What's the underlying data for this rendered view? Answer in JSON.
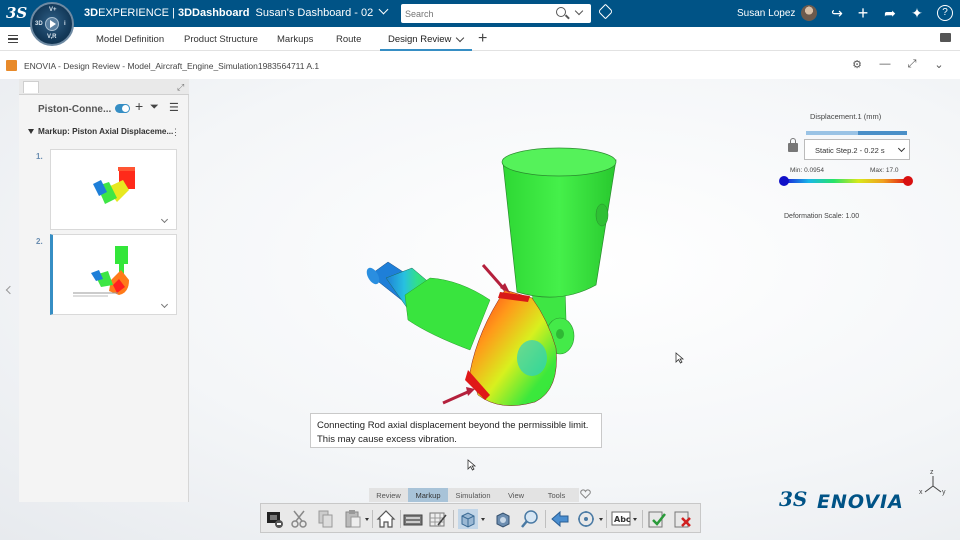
{
  "topbar": {
    "brand_bold": "3D",
    "brand_rest": "EXPERIENCE | ",
    "brand_app": "3DDashboard",
    "dashboard_name": "Susan's Dashboard - 02",
    "search_placeholder": "Search",
    "username": "Susan Lopez",
    "compass_quadrants": [
      "3D",
      "V,R",
      "i",
      "V+"
    ]
  },
  "tabs": [
    {
      "label": "Model Definition"
    },
    {
      "label": "Product Structure"
    },
    {
      "label": "Markups"
    },
    {
      "label": "Route"
    },
    {
      "label": "Design Review"
    }
  ],
  "app": {
    "title": "ENOVIA - Design Review - Model_Aircraft_Engine_Simulation1983564711 A.1"
  },
  "panel": {
    "title": "Piston-Conne...",
    "markup_label": "Markup: Piston Axial Displaceme...",
    "thumbnails": [
      {
        "num": "1."
      },
      {
        "num": "2."
      }
    ]
  },
  "legend": {
    "title": "Displacement.1 (mm)",
    "step": "Static Step.2 - 0.22 s",
    "min": "Min: 0.0954",
    "max": "Max: 17.0",
    "deformation": "Deformation Scale: 1.00"
  },
  "note": {
    "line1": "Connecting Rod axial displacement beyond the permissible limit.",
    "line2": "This may cause excess vibration."
  },
  "command_tabs": [
    {
      "label": "Review"
    },
    {
      "label": "Markup"
    },
    {
      "label": "Simulation"
    },
    {
      "label": "View"
    },
    {
      "label": "Tools"
    }
  ],
  "brand": {
    "name": "ENOVIA"
  },
  "axes": {
    "z": "z",
    "x": "x",
    "y": "y"
  },
  "colors": {
    "topbar": "#005386",
    "accent": "#368ec4",
    "part_green": "#33e63a",
    "hot_red": "#ff1a1a",
    "arrow": "#b4203c"
  }
}
